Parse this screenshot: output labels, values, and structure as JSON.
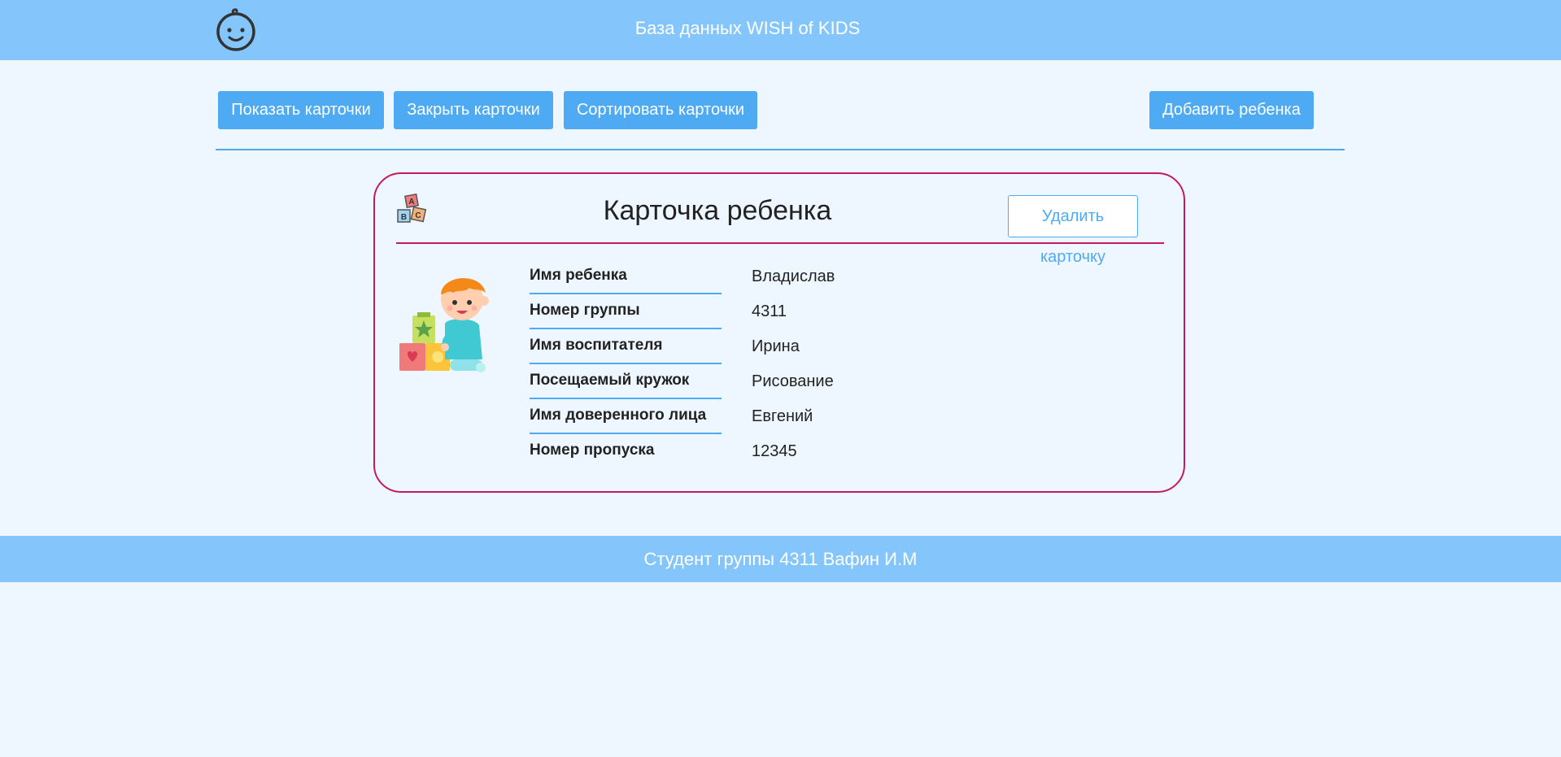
{
  "header": {
    "title": "База данных WISH of KIDS",
    "logo_icon": "baby-face-icon"
  },
  "toolbar": {
    "show_cards": "Показать карточки",
    "close_cards": "Закрыть карточки",
    "sort_cards": "Сортировать карточки",
    "add_child": "Добавить ребенка"
  },
  "card": {
    "icon": "abc-blocks-icon",
    "title": "Карточка ребенка",
    "delete_label": "Удалить карточку",
    "illustration": "child-with-toy-blocks",
    "fields": [
      {
        "label": "Имя ребенка",
        "value": "Владислав"
      },
      {
        "label": "Номер группы",
        "value": "4311"
      },
      {
        "label": "Имя воспитателя",
        "value": "Ирина"
      },
      {
        "label": "Посещаемый кружок",
        "value": "Рисование"
      },
      {
        "label": "Имя доверенного лица",
        "value": "Евгений"
      },
      {
        "label": "Номер пропуска",
        "value": "12345"
      }
    ]
  },
  "footer": {
    "text": "Студент группы 4311 Вафин И.М"
  },
  "colors": {
    "header_bg": "#84c6fc",
    "page_bg": "#eef7ff",
    "button_bg": "#4eaaf3",
    "card_border": "#c41a5c"
  }
}
